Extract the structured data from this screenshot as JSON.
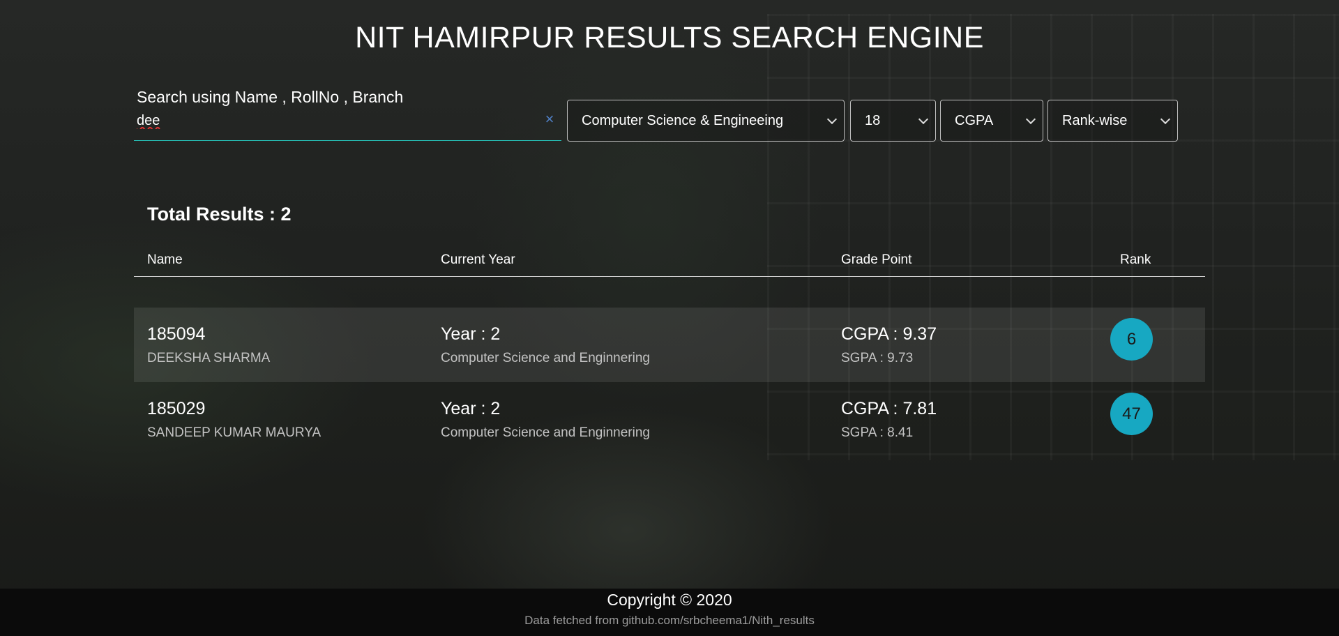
{
  "header": {
    "title": "NIT HAMIRPUR RESULTS SEARCH ENGINE"
  },
  "search": {
    "label": "Search using Name , RollNo , Branch",
    "value": "dee",
    "clear_icon": "×"
  },
  "filters": {
    "branch": "Computer Science & Engineeing",
    "batch": "18",
    "grade_type": "CGPA",
    "sort": "Rank-wise"
  },
  "summary": {
    "total_results": "Total Results : 2"
  },
  "table": {
    "columns": [
      "Name",
      "Current Year",
      "Grade Point",
      "Rank"
    ],
    "rows": [
      {
        "roll": "185094",
        "name": "DEEKSHA SHARMA",
        "year": "Year : 2",
        "branch": "Computer Science and Enginnering",
        "cgpa": "CGPA : 9.37",
        "sgpa": "SGPA : 9.73",
        "rank": "6"
      },
      {
        "roll": "185029",
        "name": "SANDEEP KUMAR MAURYA",
        "year": "Year : 2",
        "branch": "Computer Science and Enginnering",
        "cgpa": "CGPA : 7.81",
        "sgpa": "SGPA : 8.41",
        "rank": "47"
      }
    ]
  },
  "colors": {
    "accent": "#17a8c2",
    "search_underline": "#26b9b0",
    "clear_icon": "#4f7fc4",
    "footer_bg": "#0b0b0b"
  },
  "footer": {
    "copyright": "Copyright © 2020",
    "source": "Data fetched from github.com/srbcheema1/Nith_results"
  }
}
